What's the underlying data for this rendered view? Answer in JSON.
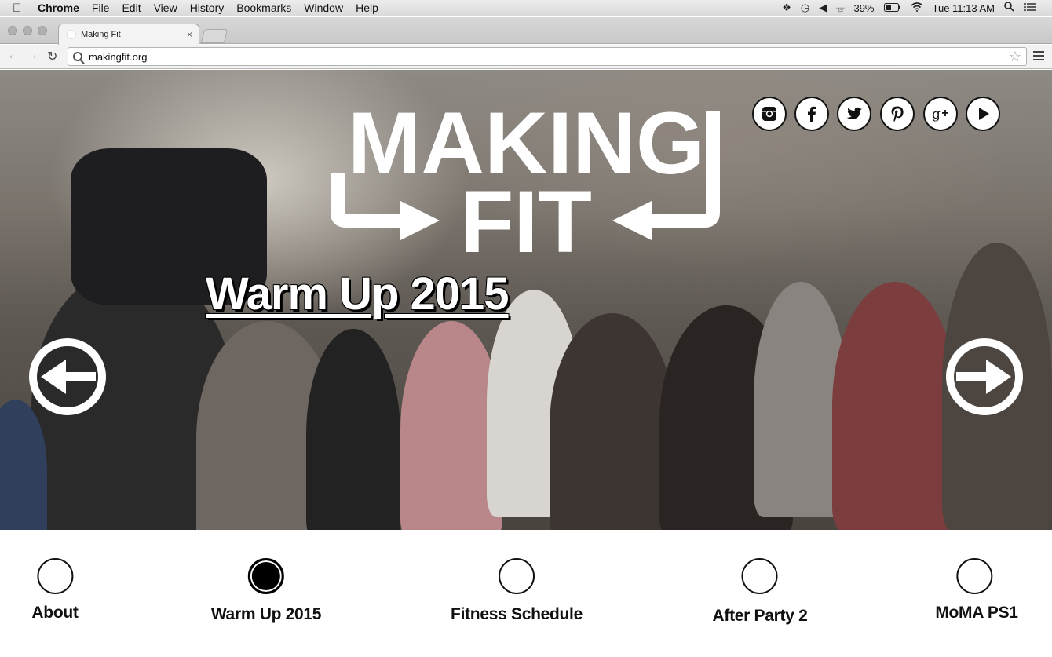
{
  "menubar": {
    "app": "Chrome",
    "items": [
      "File",
      "Edit",
      "View",
      "History",
      "Bookmarks",
      "Window",
      "Help"
    ],
    "battery": "39%",
    "clock": "Tue 11:13 AM"
  },
  "browser": {
    "tab_title": "Making Fit",
    "tab_close": "×",
    "url": "makingfit.org"
  },
  "hero": {
    "logo_line1": "MAKING",
    "logo_line2": "FIT",
    "title": "Warm Up 2015",
    "social": [
      "instagram-icon",
      "facebook-icon",
      "twitter-icon",
      "pinterest-icon",
      "google-plus-icon",
      "youtube-play-icon"
    ]
  },
  "nav": {
    "items": [
      {
        "label": "About",
        "active": false
      },
      {
        "label": "Warm Up 2015",
        "active": true
      },
      {
        "label": "Fitness Schedule",
        "active": false
      },
      {
        "label": "After Party 2",
        "active": false
      },
      {
        "label": "MoMA PS1",
        "active": false
      }
    ]
  }
}
